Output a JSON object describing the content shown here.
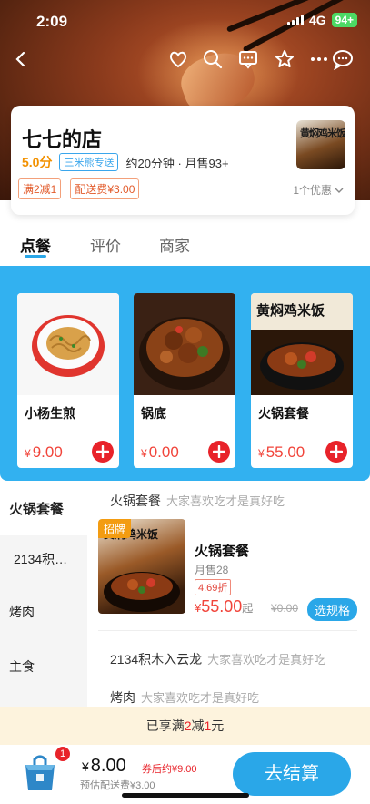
{
  "status": {
    "time": "2:09",
    "network": "4G",
    "battery": "94+"
  },
  "shop": {
    "name": "七七的店",
    "rating": "5.0分",
    "delivery_service": "三米熊专送",
    "meta": "约20分钟 · 月售93+",
    "logo_text": "黄焖鸡米饭",
    "promos": [
      "满2减1",
      "配送费¥3.00"
    ],
    "coupon_text": "1个优惠"
  },
  "tabs": [
    {
      "label": "点餐",
      "active": true
    },
    {
      "label": "评价",
      "active": false
    },
    {
      "label": "商家",
      "active": false
    }
  ],
  "featured": [
    {
      "name": "小杨生煎",
      "currency": "¥",
      "price": "9.00"
    },
    {
      "name": "锅底",
      "currency": "¥",
      "price": "0.00"
    },
    {
      "name": "火锅套餐",
      "currency": "¥",
      "price": "55.00",
      "image_text": "黄焖鸡米饭"
    }
  ],
  "categories": [
    {
      "label": "火锅套餐",
      "active": true
    },
    {
      "label": "2134积…",
      "active": false
    },
    {
      "label": "烤肉",
      "active": false
    },
    {
      "label": "主食",
      "active": false
    }
  ],
  "sections": [
    {
      "title": "火锅套餐",
      "subtitle": "大家喜欢吃才是真好吃"
    },
    {
      "title": "2134积木入云龙",
      "subtitle": "大家喜欢吃才是真好吃"
    },
    {
      "title": "烤肉",
      "subtitle": "大家喜欢吃才是真好吃"
    }
  ],
  "menu_item": {
    "badge": "招牌",
    "image_text": "黄焖鸡米饭",
    "name": "火锅套餐",
    "sales": "月售28",
    "discount": "4.69折",
    "currency": "¥",
    "price": "55.00",
    "from": "起",
    "original_price": "¥0.00",
    "spec_button": "选规格"
  },
  "promo_strip": {
    "prefix": "已享满",
    "a": "2",
    "mid": "减",
    "b": "1",
    "suffix": "元"
  },
  "cart": {
    "count": "1",
    "currency": "¥",
    "total": "8.00",
    "after_coupon": "券后约¥9.00",
    "est_fee": "预估配送费¥3.00",
    "checkout": "去结算"
  },
  "colors": {
    "accent": "#2aa7e8",
    "price": "#f1443a",
    "rating": "#f29100"
  }
}
